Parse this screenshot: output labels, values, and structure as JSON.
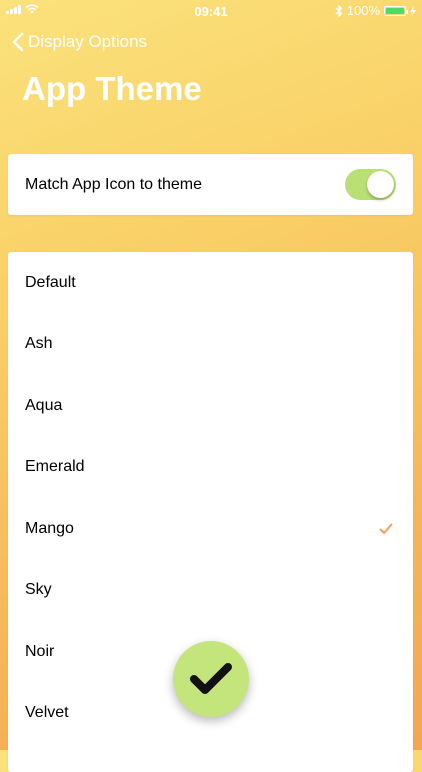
{
  "status_bar": {
    "time": "09:41",
    "battery_percent": "100%",
    "battery_level": 1.0,
    "icons": [
      "signal-icon",
      "wifi-icon",
      "bluetooth-icon",
      "battery-icon",
      "charging-icon"
    ]
  },
  "nav": {
    "back_label": "Display Options",
    "title": "App Theme"
  },
  "icon_toggle": {
    "label": "Match App Icon to theme",
    "on": true
  },
  "themes": [
    {
      "label": "Default",
      "selected": false
    },
    {
      "label": "Ash",
      "selected": false
    },
    {
      "label": "Aqua",
      "selected": false
    },
    {
      "label": "Emerald",
      "selected": false
    },
    {
      "label": "Mango",
      "selected": true
    },
    {
      "label": "Sky",
      "selected": false
    },
    {
      "label": "Noir",
      "selected": false
    },
    {
      "label": "Velvet",
      "selected": false
    }
  ],
  "colors": {
    "background_top": "#fbe27c",
    "background_bottom": "#f4a64f",
    "toggle_on": "#b9e074",
    "fab": "#c3e57c",
    "checkmark": "#f0a05a"
  }
}
